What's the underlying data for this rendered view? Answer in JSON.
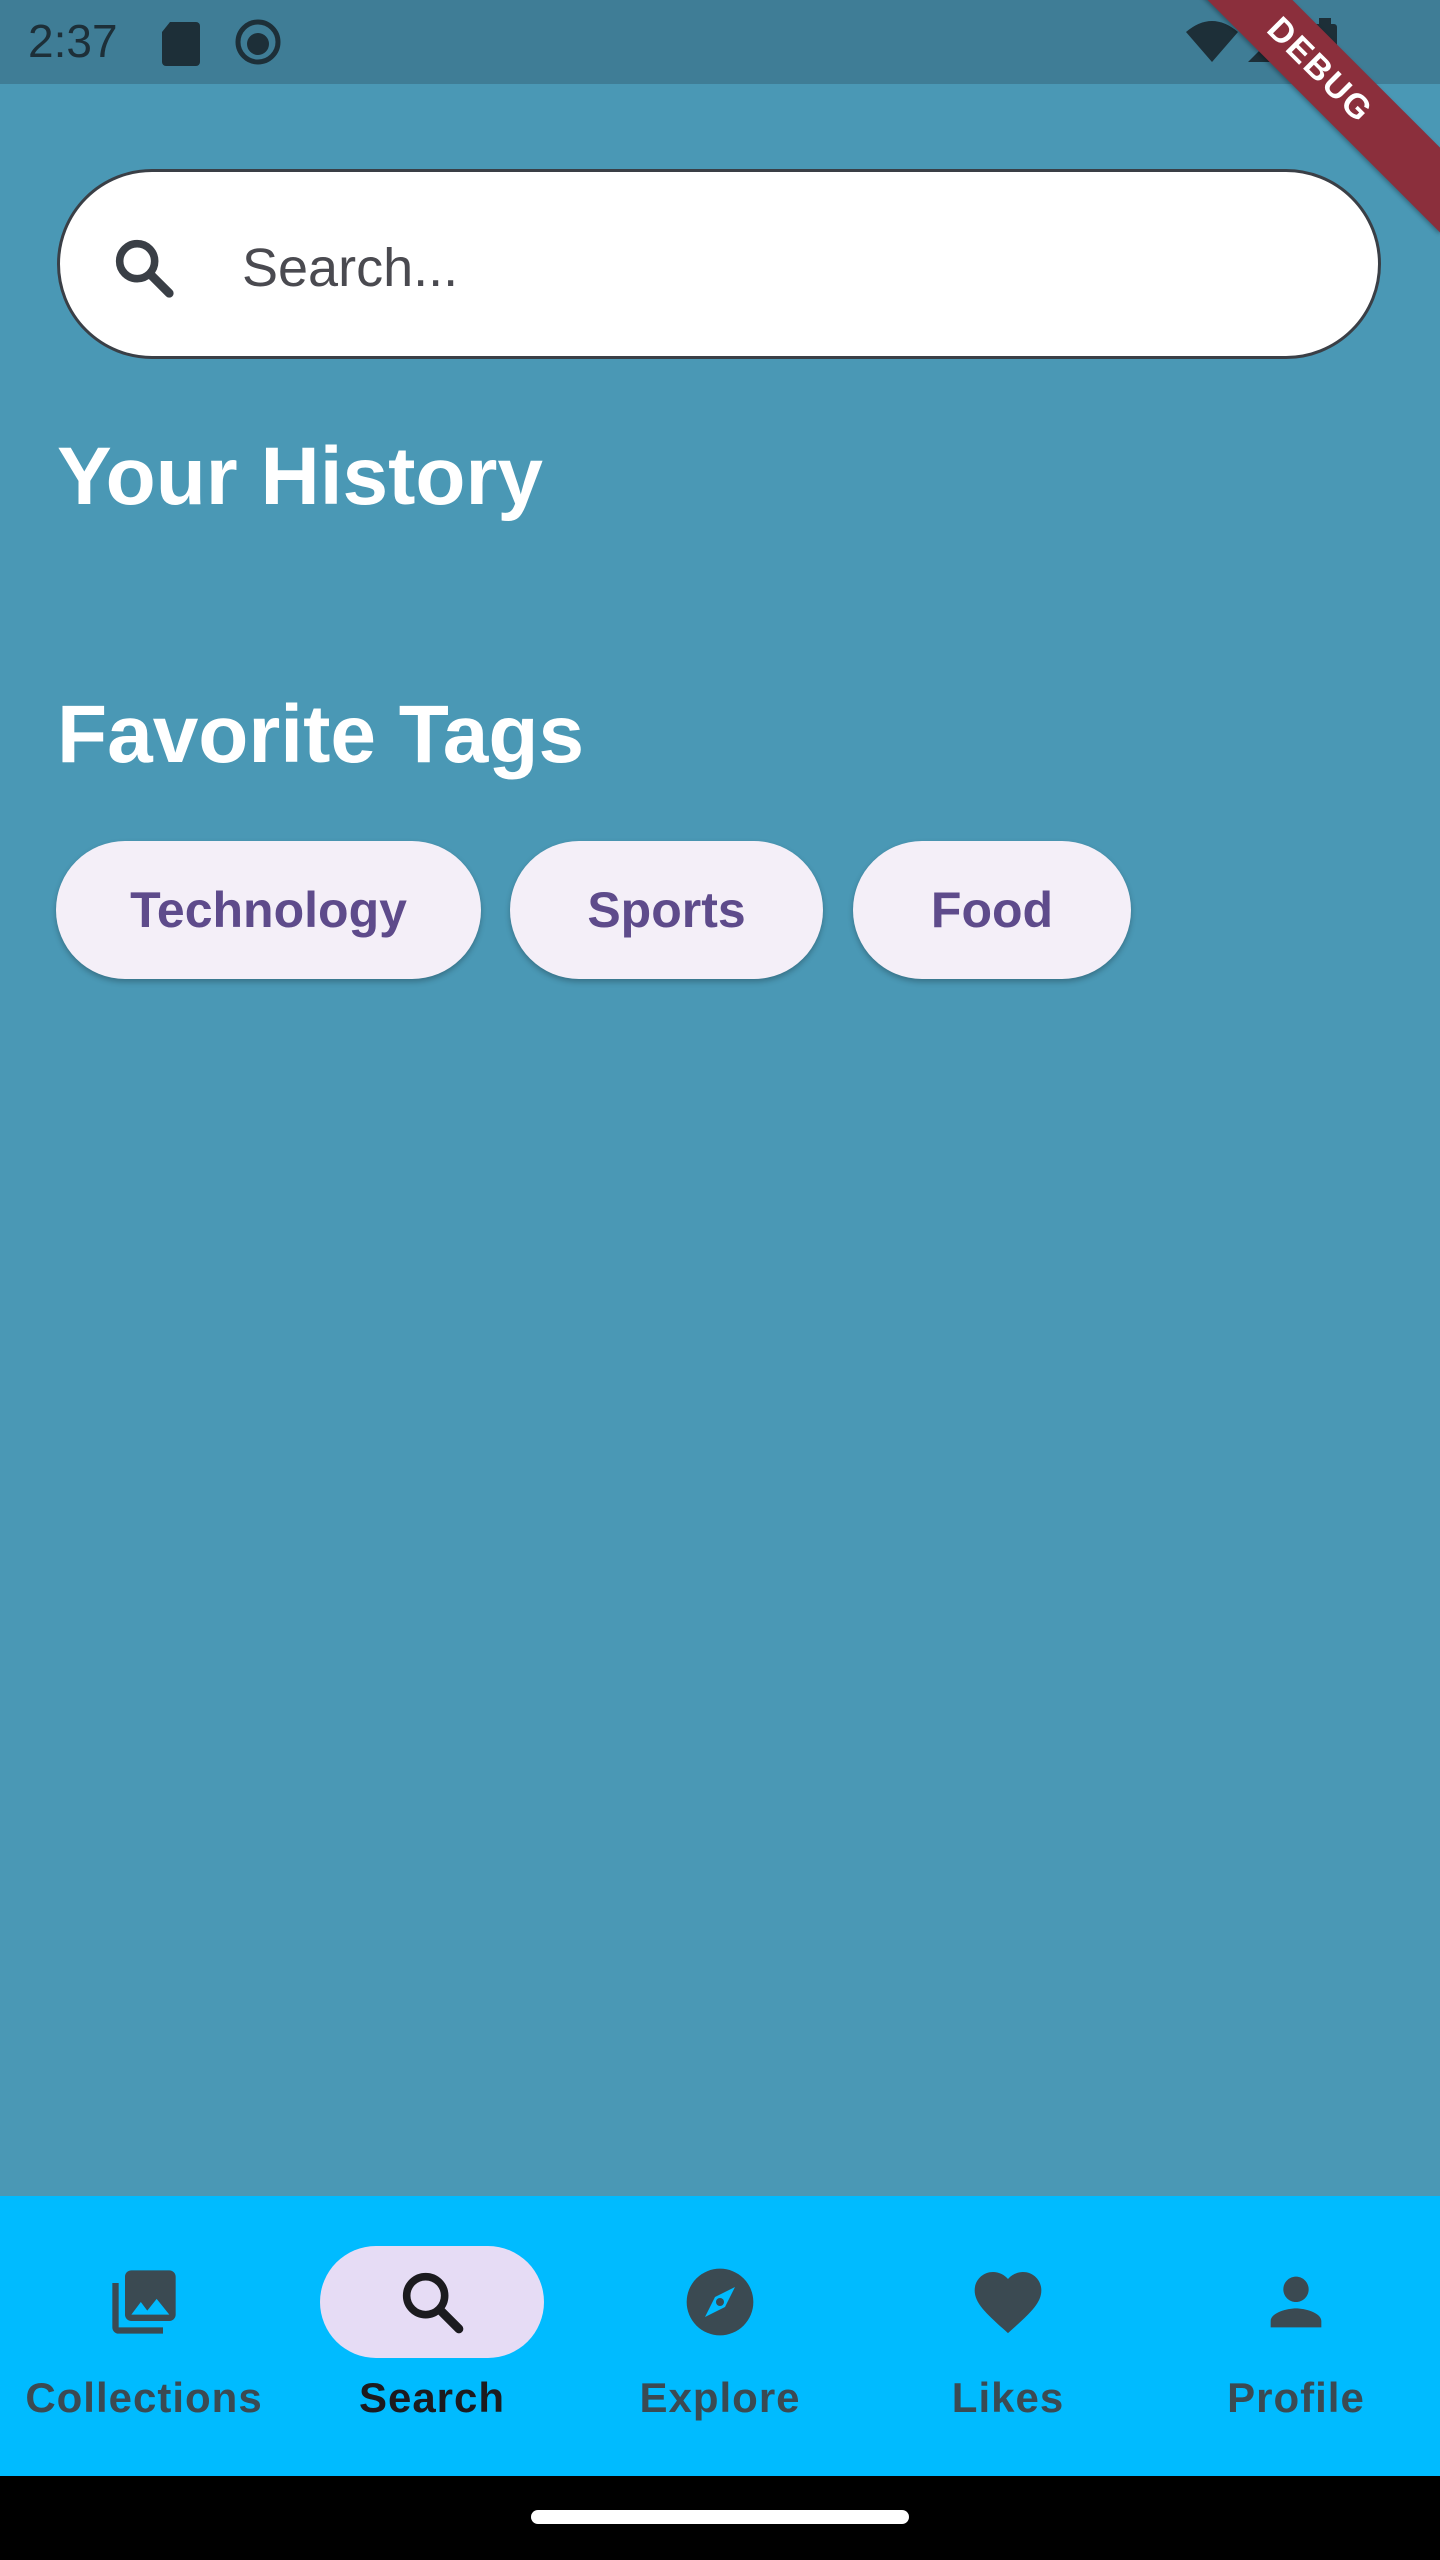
{
  "status_bar": {
    "time": "2:37",
    "debug_label": "DEBUG"
  },
  "search": {
    "placeholder": "Search..."
  },
  "sections": {
    "history_title": "Your History",
    "tags_title": "Favorite Tags"
  },
  "tags": [
    "Technology",
    "Sports",
    "Food"
  ],
  "nav": {
    "active": "Search",
    "items": [
      {
        "label": "Collections",
        "icon": "collections-icon"
      },
      {
        "label": "Search",
        "icon": "search-icon"
      },
      {
        "label": "Explore",
        "icon": "compass-icon"
      },
      {
        "label": "Likes",
        "icon": "heart-icon"
      },
      {
        "label": "Profile",
        "icon": "person-icon"
      }
    ]
  },
  "colors": {
    "background": "#4a98b5",
    "nav_background": "#00bbff",
    "chip_background": "#f4eff8",
    "chip_text": "#5e4b8b",
    "nav_active_pill": "#e6dcf5"
  }
}
